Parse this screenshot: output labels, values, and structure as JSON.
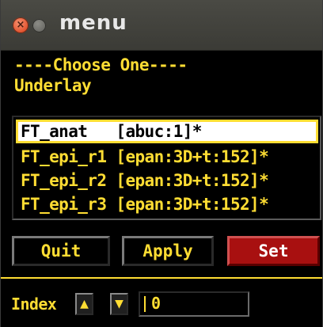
{
  "window": {
    "title": "menu"
  },
  "label": {
    "line1": "----Choose One----",
    "line2": "Underlay"
  },
  "list": {
    "items": [
      {
        "name": "FT_anat",
        "info": "[abuc:1]*",
        "selected": true
      },
      {
        "name": "FT_epi_r1",
        "info": "[epan:3D+t:152]*",
        "selected": false
      },
      {
        "name": "FT_epi_r2",
        "info": "[epan:3D+t:152]*",
        "selected": false
      },
      {
        "name": "FT_epi_r3",
        "info": "[epan:3D+t:152]*",
        "selected": false
      }
    ]
  },
  "buttons": {
    "quit": "Quit",
    "apply": "Apply",
    "set": "Set"
  },
  "index": {
    "label": "Index",
    "value": "0",
    "up_glyph": "▲",
    "down_glyph": "▼",
    "up_icon": "arrow-up-icon",
    "down_icon": "arrow-down-icon"
  },
  "colors": {
    "text": "#ffdd33",
    "set_button": "#a81010",
    "background": "#000000"
  },
  "display": {
    "item0": "FT_anat   [abuc:1]*",
    "item1": "FT_epi_r1 [epan:3D+t:152]*",
    "item2": "FT_epi_r2 [epan:3D+t:152]*",
    "item3": "FT_epi_r3 [epan:3D+t:152]*"
  }
}
